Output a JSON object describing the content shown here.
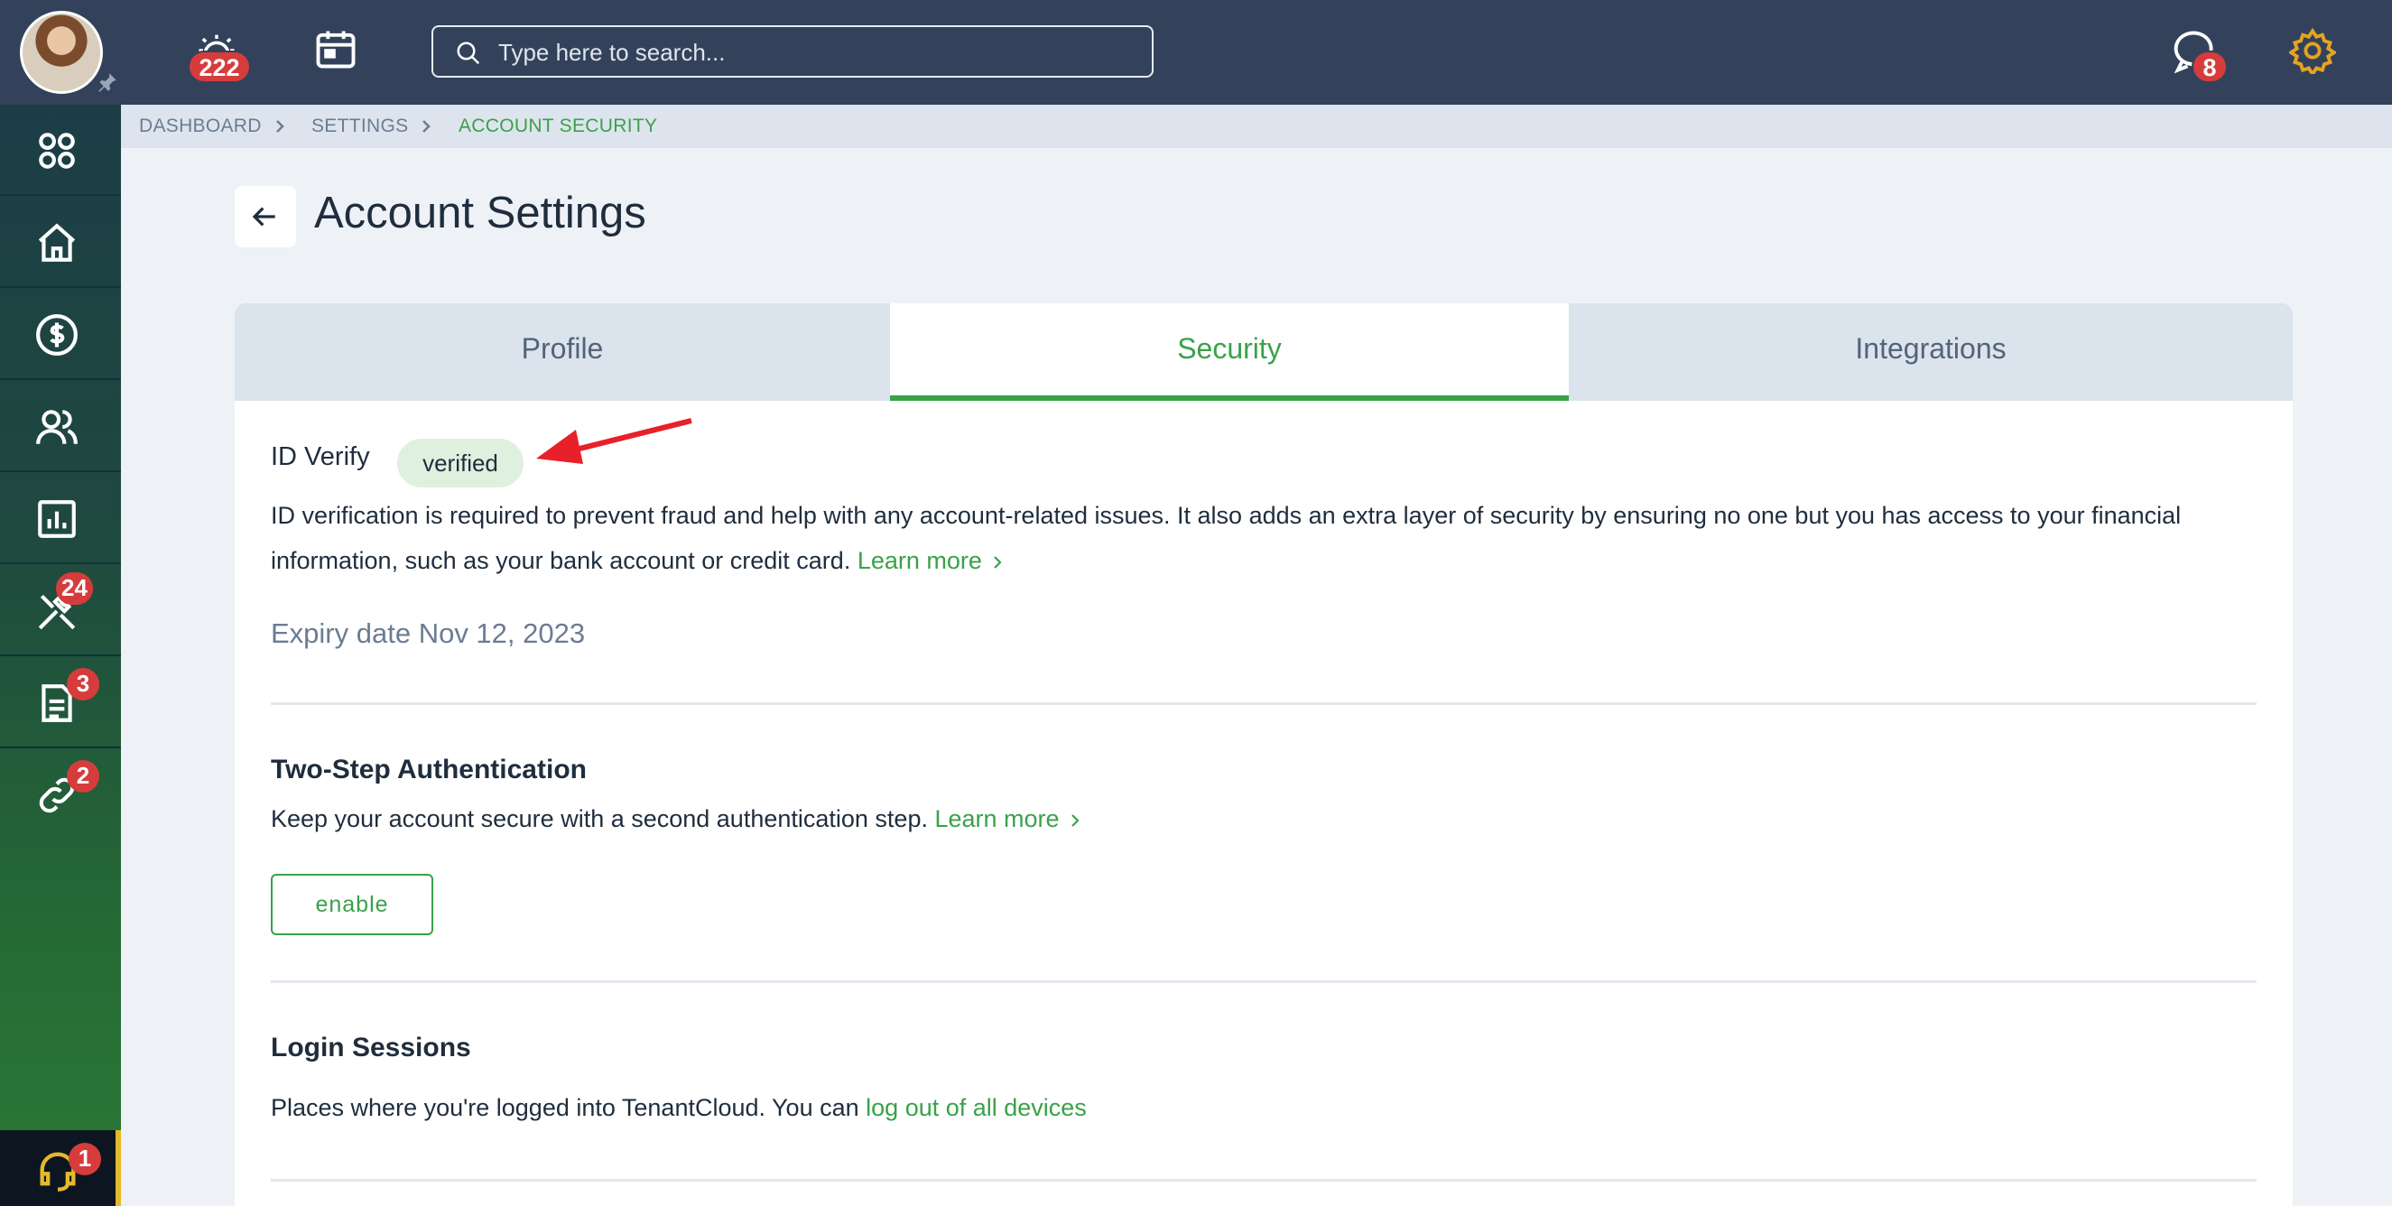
{
  "topbar": {
    "notifications_count": "222",
    "search_placeholder": "Type here to search...",
    "messages_count": "8"
  },
  "sidebar": {
    "items": [
      {
        "name": "apps",
        "icon": "grid-icon"
      },
      {
        "name": "home",
        "icon": "home-icon"
      },
      {
        "name": "payments",
        "icon": "dollar-icon"
      },
      {
        "name": "people",
        "icon": "users-icon"
      },
      {
        "name": "reports",
        "icon": "chart-icon"
      },
      {
        "name": "maintenance",
        "icon": "tools-icon",
        "badge": "24"
      },
      {
        "name": "documents",
        "icon": "document-icon",
        "badge": "3"
      },
      {
        "name": "links",
        "icon": "link-icon",
        "badge": "2"
      }
    ],
    "support_badge": "1"
  },
  "breadcrumb": {
    "items": [
      "DASHBOARD",
      "SETTINGS",
      "ACCOUNT SECURITY"
    ]
  },
  "page": {
    "title": "Account Settings"
  },
  "tabs": [
    {
      "label": "Profile",
      "active": false
    },
    {
      "label": "Security",
      "active": true
    },
    {
      "label": "Integrations",
      "active": false
    }
  ],
  "id_verify": {
    "title": "ID Verify",
    "status": "verified",
    "description_line1": "ID verification is required to prevent fraud and help with any account-related issues. It also adds an extra layer of security by ensuring no one but you has access to your financial",
    "description_line2": "information, such as your bank account or credit card.",
    "learn_more": "Learn more",
    "expiry": "Expiry date Nov 12, 2023"
  },
  "two_step": {
    "title": "Two-Step Authentication",
    "description": "Keep your account secure with a second authentication step.",
    "learn_more": "Learn more",
    "button": "enable"
  },
  "login_sessions": {
    "title": "Login Sessions",
    "description": "Places where you're logged into TenantCloud. You can",
    "link": "log out of all devices"
  },
  "colors": {
    "accent": "#3aa14a",
    "topbar": "#33425a",
    "badge": "#d63c3c",
    "settings_icon": "#e5a321",
    "annotation_arrow": "#e8202a"
  }
}
